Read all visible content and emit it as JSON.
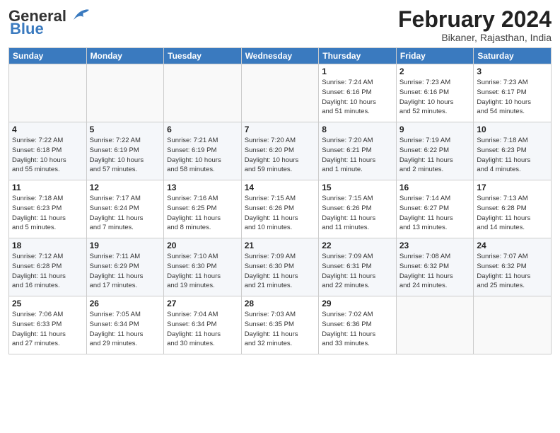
{
  "header": {
    "logo_general": "General",
    "logo_blue": "Blue",
    "month_year": "February 2024",
    "location": "Bikaner, Rajasthan, India"
  },
  "days_of_week": [
    "Sunday",
    "Monday",
    "Tuesday",
    "Wednesday",
    "Thursday",
    "Friday",
    "Saturday"
  ],
  "weeks": [
    [
      {
        "day": "",
        "info": ""
      },
      {
        "day": "",
        "info": ""
      },
      {
        "day": "",
        "info": ""
      },
      {
        "day": "",
        "info": ""
      },
      {
        "day": "1",
        "info": "Sunrise: 7:24 AM\nSunset: 6:16 PM\nDaylight: 10 hours\nand 51 minutes."
      },
      {
        "day": "2",
        "info": "Sunrise: 7:23 AM\nSunset: 6:16 PM\nDaylight: 10 hours\nand 52 minutes."
      },
      {
        "day": "3",
        "info": "Sunrise: 7:23 AM\nSunset: 6:17 PM\nDaylight: 10 hours\nand 54 minutes."
      }
    ],
    [
      {
        "day": "4",
        "info": "Sunrise: 7:22 AM\nSunset: 6:18 PM\nDaylight: 10 hours\nand 55 minutes."
      },
      {
        "day": "5",
        "info": "Sunrise: 7:22 AM\nSunset: 6:19 PM\nDaylight: 10 hours\nand 57 minutes."
      },
      {
        "day": "6",
        "info": "Sunrise: 7:21 AM\nSunset: 6:19 PM\nDaylight: 10 hours\nand 58 minutes."
      },
      {
        "day": "7",
        "info": "Sunrise: 7:20 AM\nSunset: 6:20 PM\nDaylight: 10 hours\nand 59 minutes."
      },
      {
        "day": "8",
        "info": "Sunrise: 7:20 AM\nSunset: 6:21 PM\nDaylight: 11 hours\nand 1 minute."
      },
      {
        "day": "9",
        "info": "Sunrise: 7:19 AM\nSunset: 6:22 PM\nDaylight: 11 hours\nand 2 minutes."
      },
      {
        "day": "10",
        "info": "Sunrise: 7:18 AM\nSunset: 6:23 PM\nDaylight: 11 hours\nand 4 minutes."
      }
    ],
    [
      {
        "day": "11",
        "info": "Sunrise: 7:18 AM\nSunset: 6:23 PM\nDaylight: 11 hours\nand 5 minutes."
      },
      {
        "day": "12",
        "info": "Sunrise: 7:17 AM\nSunset: 6:24 PM\nDaylight: 11 hours\nand 7 minutes."
      },
      {
        "day": "13",
        "info": "Sunrise: 7:16 AM\nSunset: 6:25 PM\nDaylight: 11 hours\nand 8 minutes."
      },
      {
        "day": "14",
        "info": "Sunrise: 7:15 AM\nSunset: 6:26 PM\nDaylight: 11 hours\nand 10 minutes."
      },
      {
        "day": "15",
        "info": "Sunrise: 7:15 AM\nSunset: 6:26 PM\nDaylight: 11 hours\nand 11 minutes."
      },
      {
        "day": "16",
        "info": "Sunrise: 7:14 AM\nSunset: 6:27 PM\nDaylight: 11 hours\nand 13 minutes."
      },
      {
        "day": "17",
        "info": "Sunrise: 7:13 AM\nSunset: 6:28 PM\nDaylight: 11 hours\nand 14 minutes."
      }
    ],
    [
      {
        "day": "18",
        "info": "Sunrise: 7:12 AM\nSunset: 6:28 PM\nDaylight: 11 hours\nand 16 minutes."
      },
      {
        "day": "19",
        "info": "Sunrise: 7:11 AM\nSunset: 6:29 PM\nDaylight: 11 hours\nand 17 minutes."
      },
      {
        "day": "20",
        "info": "Sunrise: 7:10 AM\nSunset: 6:30 PM\nDaylight: 11 hours\nand 19 minutes."
      },
      {
        "day": "21",
        "info": "Sunrise: 7:09 AM\nSunset: 6:30 PM\nDaylight: 11 hours\nand 21 minutes."
      },
      {
        "day": "22",
        "info": "Sunrise: 7:09 AM\nSunset: 6:31 PM\nDaylight: 11 hours\nand 22 minutes."
      },
      {
        "day": "23",
        "info": "Sunrise: 7:08 AM\nSunset: 6:32 PM\nDaylight: 11 hours\nand 24 minutes."
      },
      {
        "day": "24",
        "info": "Sunrise: 7:07 AM\nSunset: 6:32 PM\nDaylight: 11 hours\nand 25 minutes."
      }
    ],
    [
      {
        "day": "25",
        "info": "Sunrise: 7:06 AM\nSunset: 6:33 PM\nDaylight: 11 hours\nand 27 minutes."
      },
      {
        "day": "26",
        "info": "Sunrise: 7:05 AM\nSunset: 6:34 PM\nDaylight: 11 hours\nand 29 minutes."
      },
      {
        "day": "27",
        "info": "Sunrise: 7:04 AM\nSunset: 6:34 PM\nDaylight: 11 hours\nand 30 minutes."
      },
      {
        "day": "28",
        "info": "Sunrise: 7:03 AM\nSunset: 6:35 PM\nDaylight: 11 hours\nand 32 minutes."
      },
      {
        "day": "29",
        "info": "Sunrise: 7:02 AM\nSunset: 6:36 PM\nDaylight: 11 hours\nand 33 minutes."
      },
      {
        "day": "",
        "info": ""
      },
      {
        "day": "",
        "info": ""
      }
    ]
  ]
}
